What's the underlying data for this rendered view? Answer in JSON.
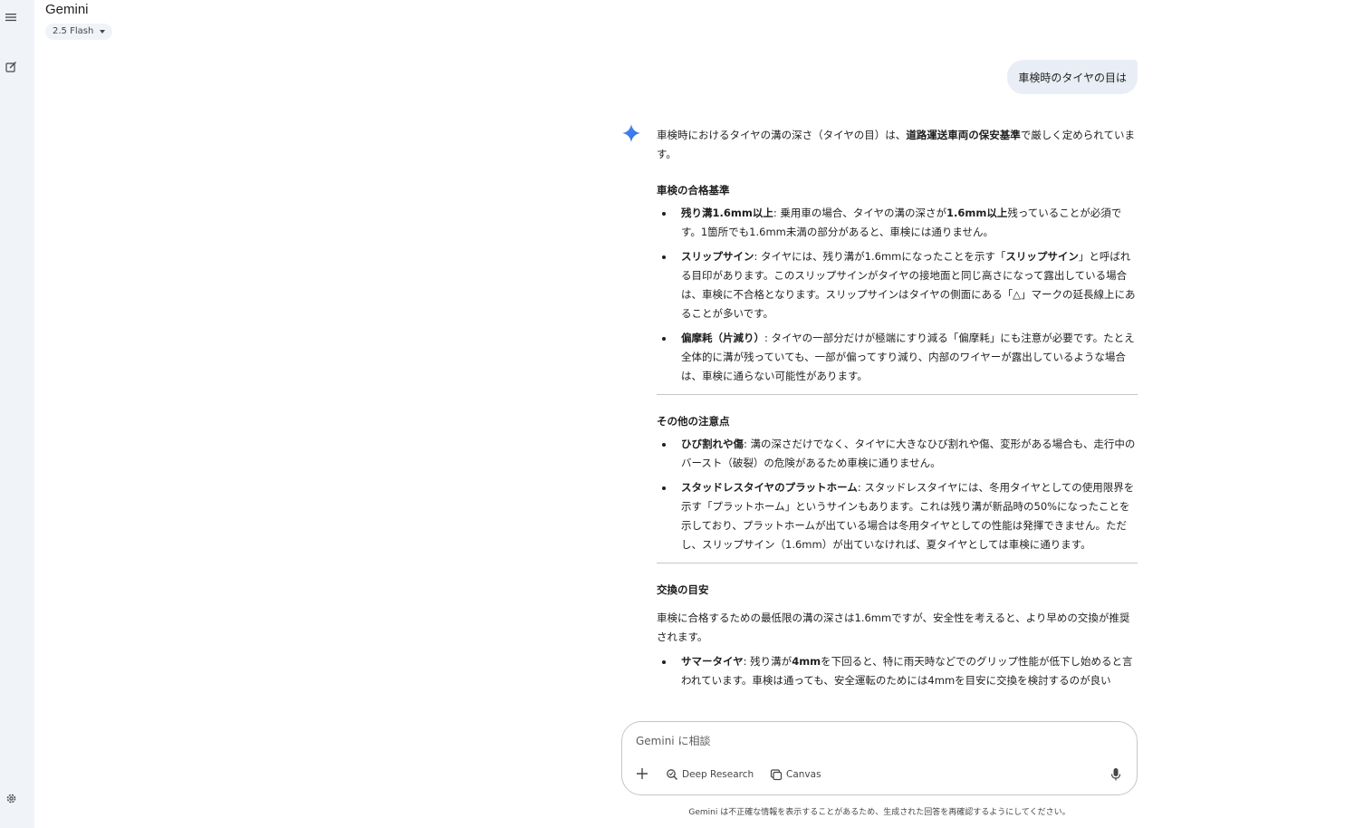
{
  "app": {
    "title": "Gemini",
    "model": "2.5 Flash"
  },
  "rail": {
    "menu_icon": "menu-icon",
    "new_chat_icon": "edit-icon",
    "settings_icon": "gear-icon"
  },
  "user_message": "車検時のタイヤの目は",
  "answer": {
    "intro_a": "車検時におけるタイヤの溝の深さ（タイヤの目）は、",
    "intro_b": "道路運送車両の保安基準",
    "intro_c": "で厳しく定められています。",
    "section1": {
      "heading": "車検の合格基準",
      "items": [
        {
          "bold": "残り溝1.6mm以上",
          "text_a": ": 乗用車の場合、タイヤの溝の深さが",
          "bold2": "1.6mm以上",
          "text_b": "残っていることが必須です。1箇所でも1.6mm未満の部分があると、車検には通りません。"
        },
        {
          "bold": "スリップサイン",
          "text_a": ": タイヤには、残り溝が1.6mmになったことを示す「",
          "bold2": "スリップサイン",
          "text_b": "」と呼ばれる目印があります。このスリップサインがタイヤの接地面と同じ高さになって露出している場合は、車検に不合格となります。スリップサインはタイヤの側面にある「△」マークの延長線上にあることが多いです。"
        },
        {
          "bold": "偏摩耗（片減り）",
          "text_a": ": タイヤの一部分だけが極端にすり減る「偏摩耗」にも注意が必要です。たとえ全体的に溝が残っていても、一部が偏ってすり減り、内部のワイヤーが露出しているような場合は、車検に通らない可能性があります。"
        }
      ]
    },
    "section2": {
      "heading": "その他の注意点",
      "items": [
        {
          "bold": "ひび割れや傷",
          "text_a": ": 溝の深さだけでなく、タイヤに大きなひび割れや傷、変形がある場合も、走行中のバースト（破裂）の危険があるため車検に通りません。"
        },
        {
          "bold": "スタッドレスタイヤのプラットホーム",
          "text_a": ": スタッドレスタイヤには、冬用タイヤとしての使用限界を示す「プラットホーム」というサインもあります。これは残り溝が新品時の50%になったことを示しており、プラットホームが出ている場合は冬用タイヤとしての性能は発揮できません。ただし、スリップサイン（1.6mm）が出ていなければ、夏タイヤとしては車検に通ります。"
        }
      ]
    },
    "section3": {
      "heading": "交換の目安",
      "paragraph": "車検に合格するための最低限の溝の深さは1.6mmですが、安全性を考えると、より早めの交換が推奨されます。",
      "items": [
        {
          "bold": "サマータイヤ",
          "text_a": ": 残り溝が",
          "bold2": "4mm",
          "text_b": "を下回ると、特に雨天時などでのグリップ性能が低下し始めると言われています。車検は通っても、安全運転のためには4mmを目安に交換を検討するのが良い"
        }
      ]
    }
  },
  "composer": {
    "placeholder": "Gemini に相談",
    "deep_research": "Deep Research",
    "canvas": "Canvas"
  },
  "disclaimer": "Gemini は不正確な情報を表示することがあるため、生成された回答を再確認するようにしてください。",
  "colors": {
    "rail_bg": "#f0f4f9",
    "bubble_bg": "#e9eef6",
    "spark_blue": "#3f7ff0"
  }
}
